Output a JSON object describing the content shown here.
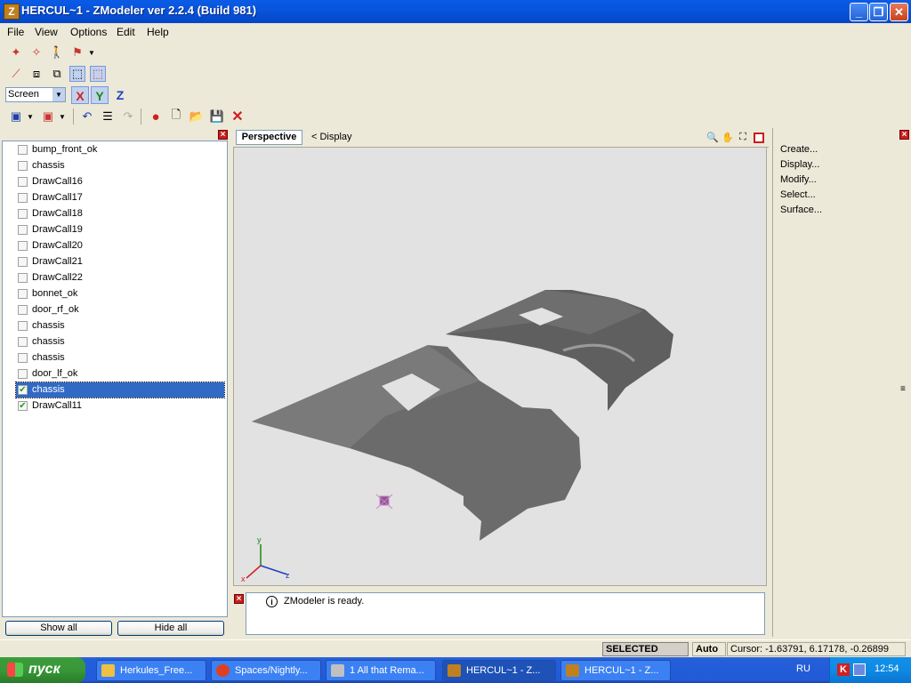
{
  "window": {
    "title": "HERCUL~1 - ZModeler ver 2.2.4 (Build 981)",
    "app_icon": "Z",
    "controls": [
      "minimize-icon",
      "restore-icon",
      "close-icon"
    ]
  },
  "menu": [
    "File",
    "View",
    "Options",
    "Edit",
    "Help"
  ],
  "toolbar": {
    "coord_mode": "Screen",
    "axes": [
      "X",
      "Y",
      "Z"
    ]
  },
  "objects": [
    {
      "name": "bump_front_ok",
      "checked": false
    },
    {
      "name": "chassis",
      "checked": false
    },
    {
      "name": "DrawCall16",
      "checked": false
    },
    {
      "name": "DrawCall17",
      "checked": false
    },
    {
      "name": "DrawCall18",
      "checked": false
    },
    {
      "name": "DrawCall19",
      "checked": false
    },
    {
      "name": "DrawCall20",
      "checked": false
    },
    {
      "name": "DrawCall21",
      "checked": false
    },
    {
      "name": "DrawCall22",
      "checked": false
    },
    {
      "name": "bonnet_ok",
      "checked": false
    },
    {
      "name": "door_rf_ok",
      "checked": false
    },
    {
      "name": "chassis",
      "checked": false
    },
    {
      "name": "chassis",
      "checked": false
    },
    {
      "name": "chassis",
      "checked": false
    },
    {
      "name": "door_lf_ok",
      "checked": false
    },
    {
      "name": "chassis",
      "checked": true,
      "selected": true
    },
    {
      "name": "DrawCall11",
      "checked": true
    }
  ],
  "left_buttons": {
    "show_all": "Show all",
    "hide_all": "Hide all"
  },
  "viewport": {
    "mode": "Perspective",
    "display": "< Display",
    "axes": {
      "x": "x",
      "y": "y",
      "z": "z"
    }
  },
  "log": {
    "message": "ZModeler is ready."
  },
  "right_menu": [
    "Create...",
    "Display...",
    "Modify...",
    "Select...",
    "Surface..."
  ],
  "status": {
    "mode": "SELECTED MODE",
    "auto": "Auto",
    "cursor": "Cursor: -1.63791, 6.17178, -0.26899"
  },
  "taskbar": {
    "start": "пуск",
    "tasks": [
      "Herkules_Free...",
      "Spaces/Nightly...",
      "1 All that Rema...",
      "HERCUL~1 - Z...",
      "HERCUL~1 - Z..."
    ],
    "lang": "RU",
    "clock": "12:54"
  },
  "colors": {
    "selection": "#316ac5",
    "viewport_bg": "#e2e2e2",
    "mesh": "#6b6b6b"
  }
}
